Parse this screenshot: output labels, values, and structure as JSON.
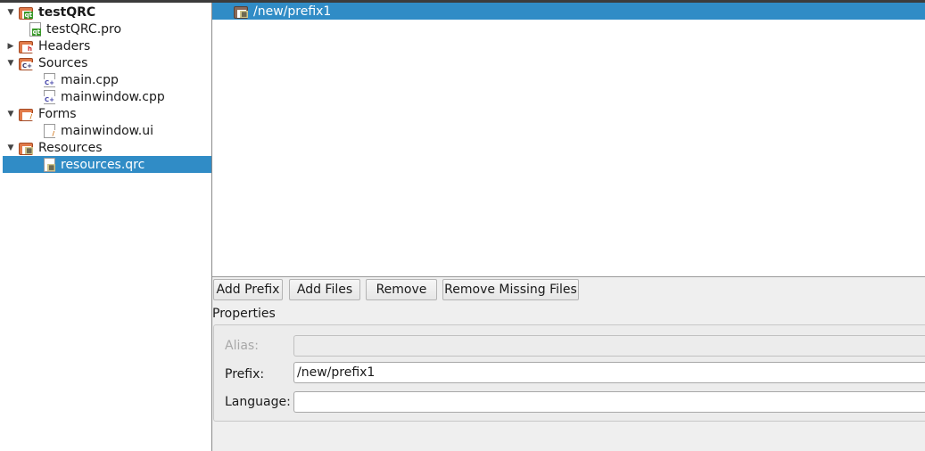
{
  "tree": [
    {
      "label": "testQRC",
      "bold": true,
      "arrow": "expanded",
      "icon": "qt-project-folder-icon"
    },
    {
      "label": "testQRC.pro",
      "arrow": "none",
      "icon": "qt-pro-file-icon",
      "indent": 1
    },
    {
      "label": "Headers",
      "arrow": "collapsed",
      "icon": "headers-folder-icon",
      "indent": 0
    },
    {
      "label": "Sources",
      "arrow": "expanded",
      "icon": "sources-folder-icon",
      "indent": 0
    },
    {
      "label": "main.cpp",
      "arrow": "none",
      "icon": "cpp-file-icon",
      "indent": 2
    },
    {
      "label": "mainwindow.cpp",
      "arrow": "none",
      "icon": "cpp-file-icon",
      "indent": 2
    },
    {
      "label": "Forms",
      "arrow": "expanded",
      "icon": "forms-folder-icon",
      "indent": 0
    },
    {
      "label": "mainwindow.ui",
      "arrow": "none",
      "icon": "ui-file-icon",
      "indent": 2
    },
    {
      "label": "Resources",
      "arrow": "expanded",
      "icon": "resources-folder-icon",
      "indent": 0
    },
    {
      "label": "resources.qrc",
      "arrow": "none",
      "icon": "qrc-file-icon",
      "indent": 2,
      "selected": true
    }
  ],
  "resource_tree": {
    "prefix": "/new/prefix1"
  },
  "buttons": {
    "add_prefix": "Add Prefix",
    "add_files": "Add Files",
    "remove": "Remove",
    "remove_missing": "Remove Missing Files"
  },
  "properties": {
    "title": "Properties",
    "alias_label": "Alias:",
    "alias_value": "",
    "prefix_label": "Prefix:",
    "prefix_value": "/new/prefix1",
    "language_label": "Language:",
    "language_value": ""
  },
  "colors": {
    "selection": "#308cc6"
  }
}
